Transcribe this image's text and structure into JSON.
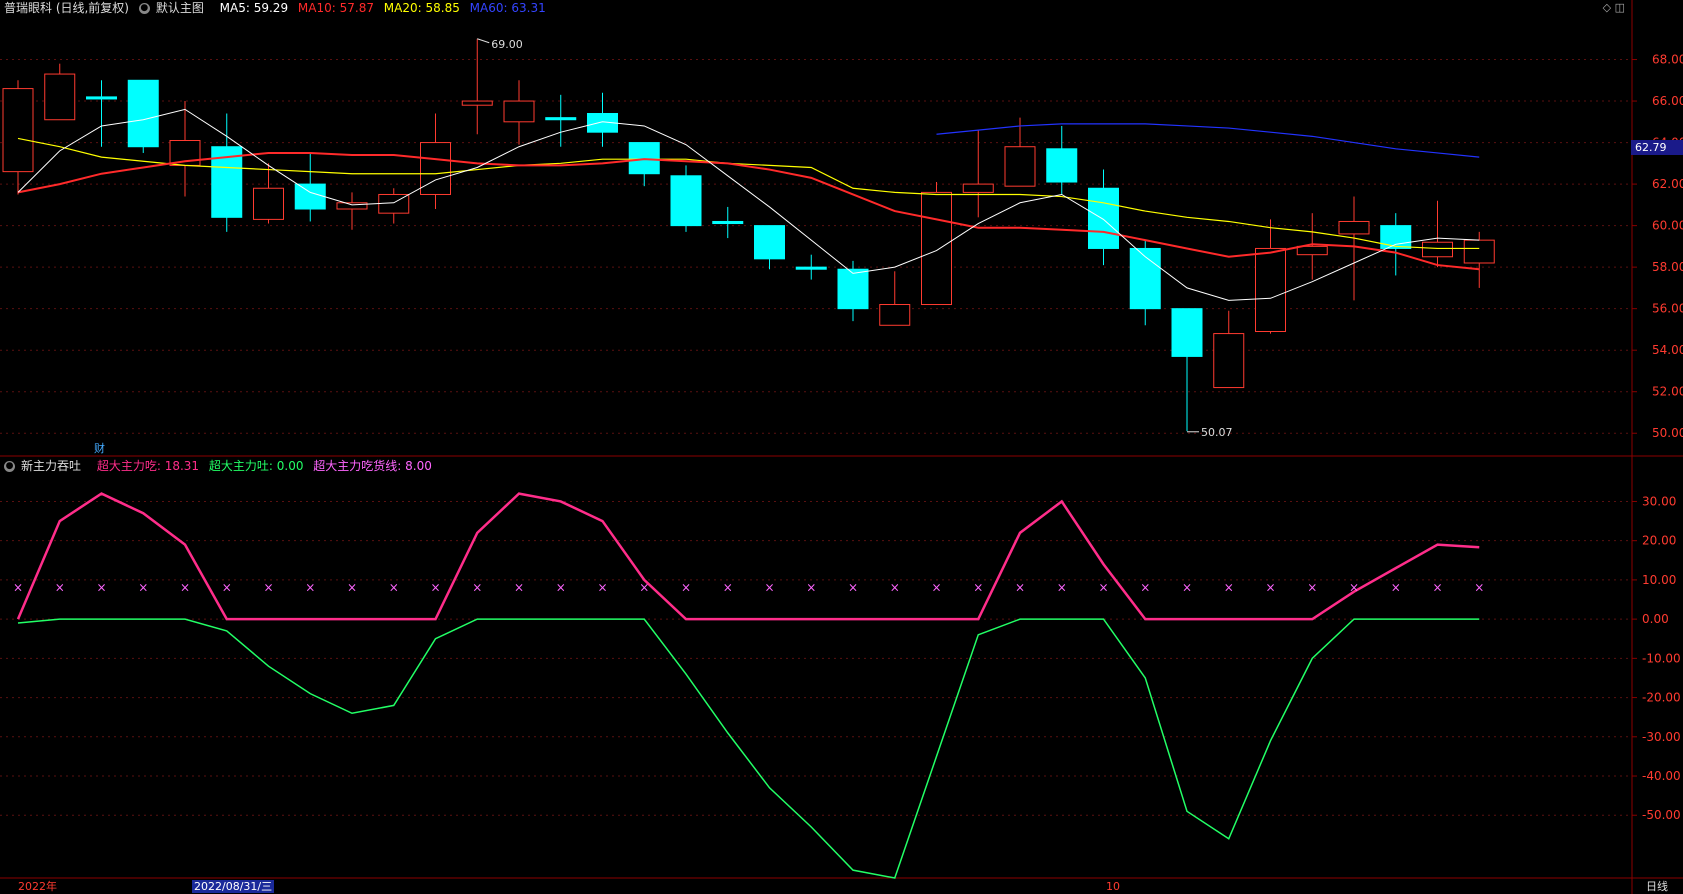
{
  "header": {
    "title": "普瑞眼科 (日线,前复权)",
    "template": "默认主图",
    "ma5": "MA5: 59.29",
    "ma10": "MA10: 57.87",
    "ma20": "MA20: 58.85",
    "ma60": "MA60: 63.31"
  },
  "sub_header": {
    "indicator": "新主力吞吐",
    "s1": "超大主力吃: 18.31",
    "s2": "超大主力吐: 0.00",
    "s3": "超大主力吃货线: 8.00"
  },
  "labels": {
    "high_mark": "69.00",
    "low_mark": "50.07",
    "price_badge": "62.79",
    "cai": "财",
    "year": "2022年",
    "date_box": "2022/08/31/三",
    "month": "10",
    "period": "日线"
  },
  "colors": {
    "up": "#ff3b30",
    "down": "#00ffff",
    "ma5": "#ffffff",
    "ma10": "#ff2a2a",
    "ma20": "#ffff00",
    "ma60": "#2233ff",
    "eat": "#ff2d8a",
    "spit": "#22ff66",
    "x": "#ff66ff",
    "axis": "#8b0000"
  },
  "chart_data": [
    {
      "type": "candlestick",
      "y_axis": {
        "ylim": [
          49,
          70
        ],
        "ticks": [
          "68.00",
          "66.00",
          "64.00",
          "62.00",
          "60.00",
          "58.00",
          "56.00",
          "54.00",
          "52.00",
          "50.00"
        ]
      },
      "candles": [
        {
          "o": 62.6,
          "c": 66.6,
          "h": 67.0,
          "l": 61.5
        },
        {
          "o": 65.1,
          "c": 67.3,
          "h": 67.8,
          "l": 65.1
        },
        {
          "o": 66.2,
          "c": 66.1,
          "h": 67.0,
          "l": 63.8
        },
        {
          "o": 67.0,
          "c": 63.8,
          "h": 67.0,
          "l": 63.5
        },
        {
          "o": 62.9,
          "c": 64.1,
          "h": 66.0,
          "l": 61.4
        },
        {
          "o": 63.8,
          "c": 60.4,
          "h": 65.4,
          "l": 59.7
        },
        {
          "o": 60.3,
          "c": 61.8,
          "h": 63.0,
          "l": 60.1
        },
        {
          "o": 62.0,
          "c": 60.8,
          "h": 63.5,
          "l": 60.2
        },
        {
          "o": 60.8,
          "c": 61.1,
          "h": 61.6,
          "l": 59.8
        },
        {
          "o": 60.6,
          "c": 61.5,
          "h": 61.8,
          "l": 60.1
        },
        {
          "o": 61.5,
          "c": 64.0,
          "h": 65.4,
          "l": 60.8
        },
        {
          "o": 65.8,
          "c": 66.0,
          "h": 69.0,
          "l": 64.4
        },
        {
          "o": 65.0,
          "c": 66.0,
          "h": 67.0,
          "l": 63.9
        },
        {
          "o": 65.2,
          "c": 65.1,
          "h": 66.3,
          "l": 63.8
        },
        {
          "o": 65.4,
          "c": 64.5,
          "h": 66.4,
          "l": 63.8
        },
        {
          "o": 64.0,
          "c": 62.5,
          "h": 64.0,
          "l": 61.9
        },
        {
          "o": 62.4,
          "c": 60.0,
          "h": 62.9,
          "l": 59.7
        },
        {
          "o": 60.2,
          "c": 60.1,
          "h": 60.9,
          "l": 59.4
        },
        {
          "o": 60.0,
          "c": 58.4,
          "h": 60.0,
          "l": 57.9
        },
        {
          "o": 58.0,
          "c": 57.9,
          "h": 58.6,
          "l": 57.4
        },
        {
          "o": 57.9,
          "c": 56.0,
          "h": 58.3,
          "l": 55.4
        },
        {
          "o": 55.2,
          "c": 56.2,
          "h": 57.8,
          "l": 55.2
        },
        {
          "o": 56.2,
          "c": 61.6,
          "h": 62.1,
          "l": 56.2
        },
        {
          "o": 61.6,
          "c": 62.0,
          "h": 64.6,
          "l": 60.4
        },
        {
          "o": 61.9,
          "c": 63.8,
          "h": 65.2,
          "l": 61.9
        },
        {
          "o": 63.7,
          "c": 62.1,
          "h": 64.8,
          "l": 61.5
        },
        {
          "o": 61.8,
          "c": 58.9,
          "h": 62.7,
          "l": 58.1
        },
        {
          "o": 58.9,
          "c": 56.0,
          "h": 59.3,
          "l": 55.2
        },
        {
          "o": 56.0,
          "c": 53.7,
          "h": 56.0,
          "l": 50.1
        },
        {
          "o": 52.2,
          "c": 54.8,
          "h": 55.9,
          "l": 52.2
        },
        {
          "o": 54.9,
          "c": 58.9,
          "h": 60.3,
          "l": 54.8
        },
        {
          "o": 58.6,
          "c": 59.0,
          "h": 60.6,
          "l": 57.4
        },
        {
          "o": 59.6,
          "c": 60.2,
          "h": 61.4,
          "l": 56.4
        },
        {
          "o": 60.0,
          "c": 58.9,
          "h": 60.6,
          "l": 57.6
        },
        {
          "o": 58.5,
          "c": 59.2,
          "h": 61.2,
          "l": 58.0
        },
        {
          "o": 58.2,
          "c": 59.3,
          "h": 59.7,
          "l": 57.0
        }
      ],
      "ma5": [
        61.6,
        63.6,
        64.8,
        65.1,
        65.6,
        64.3,
        62.9,
        61.6,
        61.0,
        61.1,
        62.2,
        62.8,
        63.8,
        64.5,
        65.0,
        64.8,
        63.9,
        62.4,
        60.9,
        59.3,
        57.7,
        58.0,
        58.8,
        60.1,
        61.1,
        61.5,
        60.3,
        58.5,
        57.0,
        56.4,
        56.5,
        57.3,
        58.2,
        59.1,
        59.4,
        59.3
      ],
      "ma10": [
        61.6,
        62.0,
        62.5,
        62.8,
        63.1,
        63.3,
        63.5,
        63.5,
        63.4,
        63.4,
        63.2,
        63.0,
        62.9,
        62.9,
        63.0,
        63.2,
        63.1,
        63.0,
        62.7,
        62.3,
        61.5,
        60.7,
        60.3,
        59.9,
        59.9,
        59.8,
        59.7,
        59.3,
        58.9,
        58.5,
        58.7,
        59.1,
        59.0,
        58.7,
        58.1,
        57.9
      ],
      "ma20": [
        64.2,
        63.8,
        63.3,
        63.1,
        62.9,
        62.8,
        62.7,
        62.6,
        62.5,
        62.5,
        62.5,
        62.7,
        62.9,
        63.0,
        63.2,
        63.2,
        63.2,
        63.0,
        62.9,
        62.8,
        61.8,
        61.6,
        61.5,
        61.5,
        61.5,
        61.4,
        61.1,
        60.7,
        60.4,
        60.2,
        59.9,
        59.7,
        59.4,
        59.0,
        58.9,
        58.9
      ],
      "ma60_start": 22,
      "ma60": [
        64.4,
        64.6,
        64.8,
        64.9,
        64.9,
        64.9,
        64.8,
        64.7,
        64.5,
        64.3,
        64.0,
        63.7,
        63.5,
        63.3
      ],
      "marks": {
        "high": 69.0,
        "low": 50.07
      }
    },
    {
      "type": "line",
      "title": "新主力吞吐",
      "y_axis": {
        "ylim": [
          -66,
          37
        ],
        "ticks": [
          "30.00",
          "20.00",
          "10.00",
          "0.00",
          "-10.00",
          "-20.00",
          "-30.00",
          "-40.00",
          "-50.00"
        ]
      },
      "series": [
        {
          "name": "超大主力吃",
          "values": [
            0,
            25,
            32,
            27,
            19,
            0,
            0,
            0,
            0,
            0,
            0,
            22,
            32,
            30,
            25,
            10,
            0,
            0,
            0,
            0,
            0,
            0,
            0,
            0,
            22,
            30,
            14,
            0,
            0,
            0,
            0,
            0,
            7,
            13,
            19,
            18.31
          ]
        },
        {
          "name": "超大主力吐",
          "values": [
            -1,
            0,
            0,
            0,
            0,
            -3,
            -12,
            -19,
            -24,
            -22,
            -5,
            0,
            0,
            0,
            0,
            0,
            -14,
            -29,
            -43,
            -53,
            -64,
            -66,
            -35,
            -4,
            0,
            0,
            0,
            -15,
            -49,
            -56,
            -31,
            -10,
            0,
            0,
            0,
            0
          ]
        },
        {
          "name": "超大主力吃货线",
          "values": [
            8,
            8,
            8,
            8,
            8,
            8,
            8,
            8,
            8,
            8,
            8,
            8,
            8,
            8,
            8,
            8,
            8,
            8,
            8,
            8,
            8,
            8,
            8,
            8,
            8,
            8,
            8,
            8,
            8,
            8,
            8,
            8,
            8,
            8,
            8,
            8
          ]
        }
      ]
    }
  ]
}
